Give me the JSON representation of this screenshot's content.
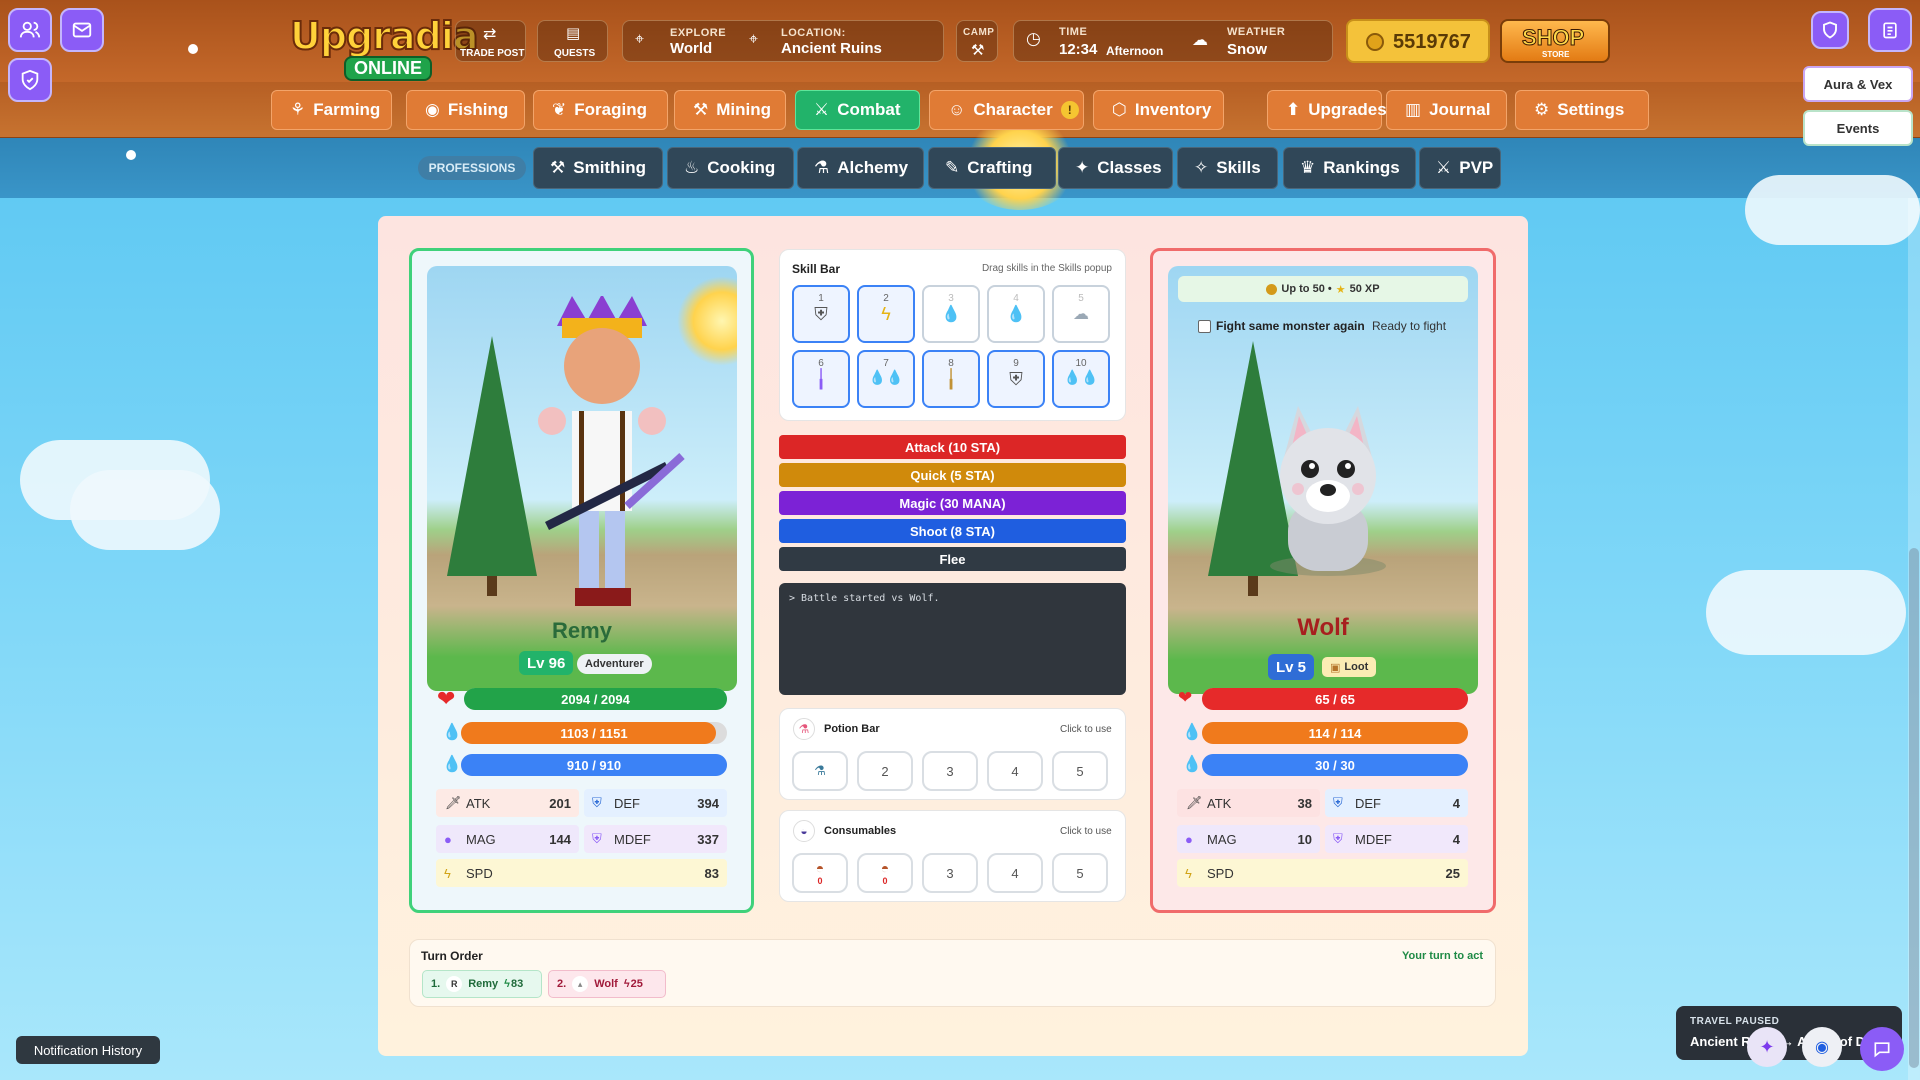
{
  "header": {
    "logo_line1": "Upgradia",
    "logo_line2": "ONLINE",
    "trade_post": "TRADE POST",
    "quests": "QUESTS",
    "explore_label": "EXPLORE",
    "explore_value": "World",
    "location_label": "LOCATION:",
    "location_value": "Ancient Ruins",
    "camp_label": "CAMP",
    "time_label": "TIME",
    "time_value": "12:34",
    "time_period": "Afternoon",
    "weather_label": "WEATHER",
    "weather_value": "Snow",
    "gold": "5519767",
    "shop_label": "SHOP",
    "shop_sub": "STORE"
  },
  "side": {
    "aura_vex": "Aura & Vex",
    "events": "Events"
  },
  "nav": {
    "tabs": [
      "Farming",
      "Fishing",
      "Foraging",
      "Mining",
      "Combat",
      "Character",
      "Inventory",
      "Upgrades",
      "Journal",
      "Settings"
    ],
    "character_badge": "!"
  },
  "professions": {
    "label": "PROFESSIONS",
    "tabs": [
      "Smithing",
      "Cooking",
      "Alchemy",
      "Crafting",
      "Classes",
      "Skills",
      "Rankings",
      "PVP"
    ]
  },
  "player": {
    "name": "Remy",
    "level": "Lv 96",
    "class": "Adventurer",
    "hp_text": "2094 / 2094",
    "hp_fraction": 1.0,
    "sta_text": "1103 / 1151",
    "sta_fraction": 0.958,
    "mana_text": "910 / 910",
    "mana_fraction": 1.0,
    "stats": {
      "atk_label": "ATK",
      "atk": "201",
      "def_label": "DEF",
      "def": "394",
      "mag_label": "MAG",
      "mag": "144",
      "mdef_label": "MDEF",
      "mdef": "337",
      "spd_label": "SPD",
      "spd": "83"
    }
  },
  "skillbar": {
    "title": "Skill Bar",
    "hint": "Drag skills in the Skills popup",
    "slots": [
      "1",
      "2",
      "3",
      "4",
      "5",
      "6",
      "7",
      "8",
      "9",
      "10"
    ]
  },
  "actions": {
    "attack": "Attack (10 STA)",
    "quick": "Quick (5 STA)",
    "magic": "Magic (30 MANA)",
    "shoot": "Shoot (8 STA)",
    "flee": "Flee"
  },
  "log": {
    "line1": "> Battle started vs Wolf."
  },
  "potions": {
    "title": "Potion Bar",
    "hint": "Click to use",
    "slots": [
      "",
      "2",
      "3",
      "4",
      "5"
    ]
  },
  "consumables": {
    "title": "Consumables",
    "hint": "Click to use",
    "slots": [
      "0",
      "0",
      "3",
      "4",
      "5"
    ]
  },
  "enemy": {
    "reward": "Up to 50 •",
    "reward_xp": "50 XP",
    "fight_again": "Fight same monster again",
    "ready": "Ready to fight",
    "name": "Wolf",
    "level": "Lv 5",
    "loot": "Loot",
    "hp_text": "65 / 65",
    "hp_fraction": 1.0,
    "sta_text": "114 / 114",
    "sta_fraction": 1.0,
    "mana_text": "30 / 30",
    "mana_fraction": 1.0,
    "stats": {
      "atk_label": "ATK",
      "atk": "38",
      "def_label": "DEF",
      "def": "4",
      "mag_label": "MAG",
      "mag": "10",
      "mdef_label": "MDEF",
      "mdef": "4",
      "spd_label": "SPD",
      "spd": "25"
    }
  },
  "turn_order": {
    "title": "Turn Order",
    "status": "Your turn to act",
    "p1_index": "1.",
    "p1_initial": "R",
    "p1_name": "Remy",
    "p1_spd": "83",
    "p2_index": "2.",
    "p2_name": "Wolf",
    "p2_spd": "25"
  },
  "footer": {
    "notification_history": "Notification History",
    "travel_label": "TRAVEL PAUSED",
    "travel_value": "Ancient Ruins → Abyss of Dead"
  },
  "colors": {
    "hp": "#e62a2a",
    "stamina": "#f07a1c",
    "mana": "#3b82f6",
    "player_border": "#3fd17a",
    "enemy_border": "#f06b6b",
    "active_tab": "#22b36a"
  }
}
